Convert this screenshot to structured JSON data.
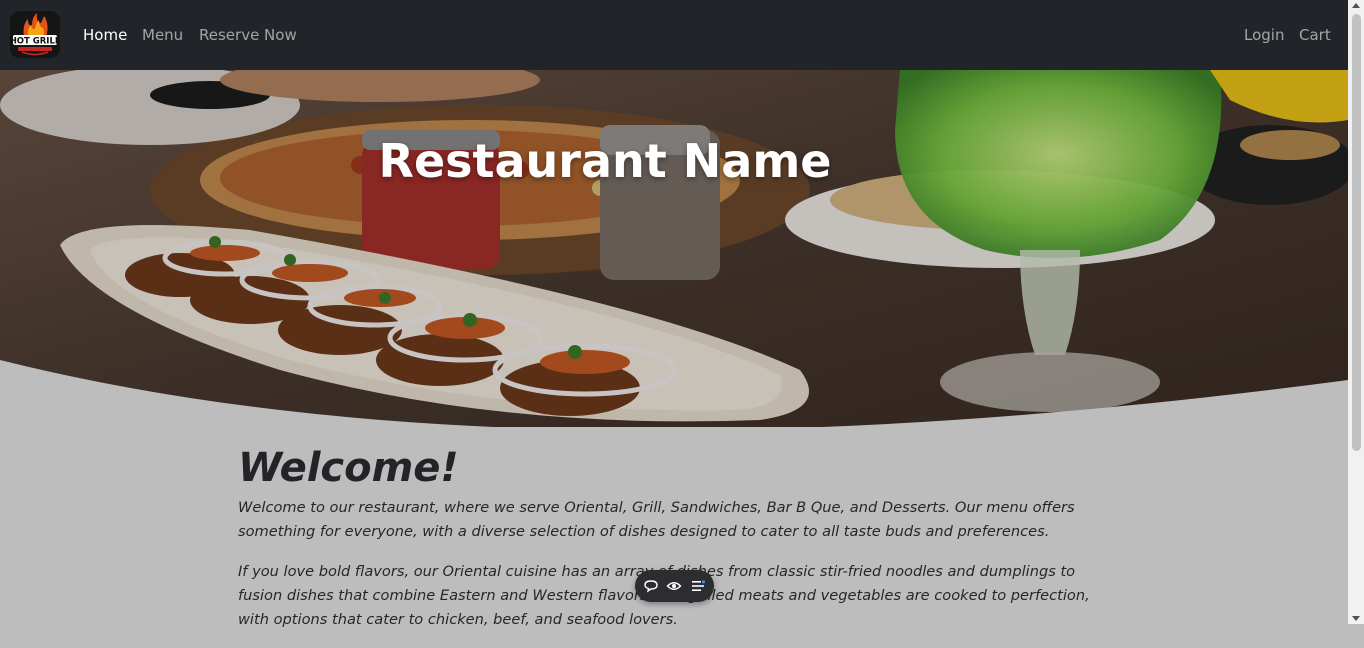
{
  "navbar": {
    "logo_text": "HOT GRILL",
    "links": [
      {
        "label": "Home",
        "active": true
      },
      {
        "label": "Menu",
        "active": false
      },
      {
        "label": "Reserve Now",
        "active": false
      }
    ],
    "right_links": [
      {
        "label": "Login"
      },
      {
        "label": "Cart"
      }
    ]
  },
  "hero": {
    "title": "Restaurant Name"
  },
  "content": {
    "heading": "Welcome!",
    "paragraphs": [
      "Welcome to our restaurant, where we serve Oriental, Grill, Sandwiches, Bar B Que, and Desserts. Our menu offers something for everyone, with a diverse selection of dishes designed to cater to all taste buds and preferences.",
      "If you love bold flavors, our Oriental cuisine has an array of dishes from classic stir-fried noodles and dumplings to fusion dishes that combine Eastern and Western flavors. Our grilled meats and vegetables are cooked to perfection, with options that cater to chicken, beef, and seafood lovers."
    ]
  },
  "toolbar": {
    "icons": [
      "chat-icon",
      "eye-icon",
      "list-icon"
    ]
  },
  "colors": {
    "navbar_bg": "#212529",
    "page_bg": "#bdbdbd",
    "link_active": "#ffffff",
    "link_muted": "#9a9da0"
  }
}
